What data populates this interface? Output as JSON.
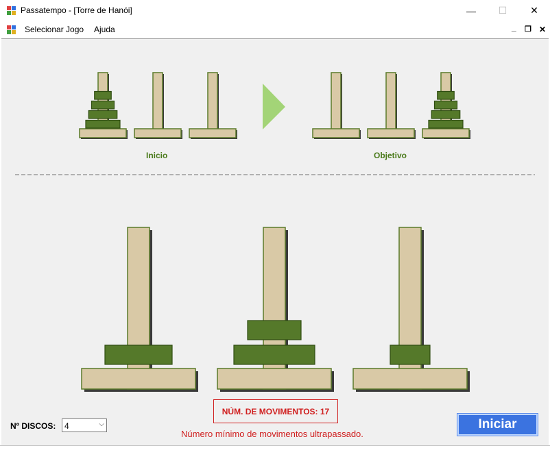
{
  "window": {
    "title": "Passatempo - [Torre de Hanói]",
    "minimize_glyph": "—",
    "maximize_glyph": "☐",
    "close_glyph": "✕"
  },
  "menu": {
    "items": [
      "Selecionar Jogo",
      "Ajuda"
    ],
    "mdi_min": "_",
    "mdi_restore": "❐",
    "mdi_close": "✕"
  },
  "preview": {
    "start_caption": "Inicio",
    "goal_caption": "Objetivo",
    "start_pegs": [
      4,
      0,
      0
    ],
    "goal_pegs": [
      0,
      0,
      4
    ],
    "arrow_color": "#a3d477"
  },
  "board": {
    "pegs": [
      [
        3
      ],
      [
        4,
        2
      ],
      [
        1
      ]
    ]
  },
  "status": {
    "moves_text": "NÚM. DE MOVIMENTOS: 17",
    "warning": "Número mínimo de movimentos ultrapassado."
  },
  "controls": {
    "discs_label": "Nº DISCOS:",
    "discs_value": "4",
    "start_button": "Iniciar"
  },
  "colors": {
    "peg": "#d9c9a6",
    "disk": "#55792a",
    "alert": "#d02020",
    "button": "#3b73e0"
  }
}
